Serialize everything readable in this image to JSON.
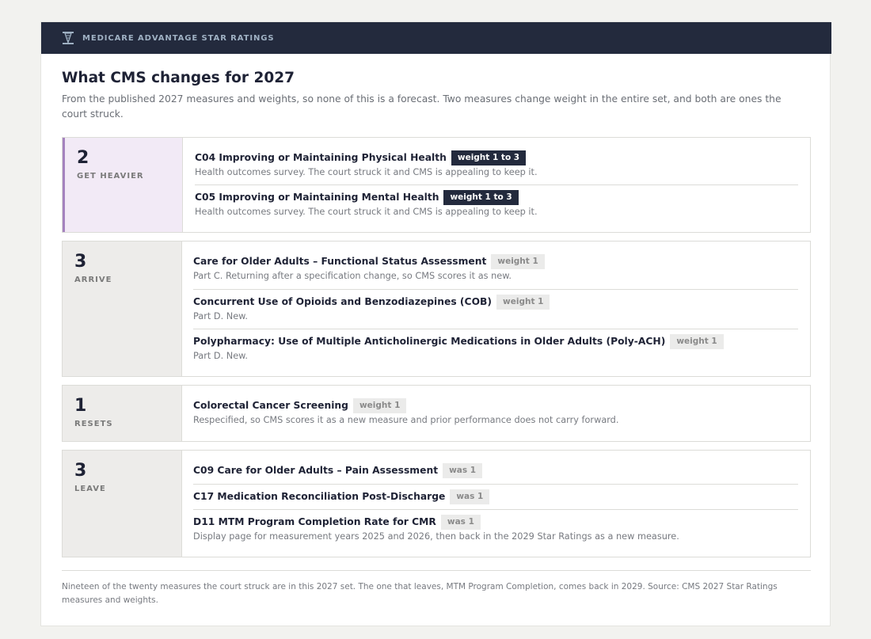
{
  "header": {
    "brand": "MEDICARE ADVANTAGE STAR RATINGS",
    "logo_icon": "scales-column-icon"
  },
  "title": "What CMS changes for 2027",
  "intro": "From the published 2027 measures and weights, so none of this is a forecast. Two measures change weight in the entire set, and both are ones the court struck.",
  "groups": [
    {
      "count": "2",
      "label": "GET HEAVIER",
      "items": [
        {
          "name": "C04 Improving or Maintaining Physical Health",
          "badge": "weight 1 to 3",
          "note": "Health outcomes survey. The court struck it and CMS is appealing to keep it."
        },
        {
          "name": "C05 Improving or Maintaining Mental Health",
          "badge": "weight 1 to 3",
          "note": "Health outcomes survey. The court struck it and CMS is appealing to keep it."
        }
      ]
    },
    {
      "count": "3",
      "label": "ARRIVE",
      "items": [
        {
          "name": "Care for Older Adults – Functional Status Assessment",
          "badge": "weight 1",
          "note": "Part C. Returning after a specification change, so CMS scores it as new."
        },
        {
          "name": "Concurrent Use of Opioids and Benzodiazepines (COB)",
          "badge": "weight 1",
          "note": "Part D. New."
        },
        {
          "name": "Polypharmacy: Use of Multiple Anticholinergic Medications in Older Adults (Poly-ACH)",
          "badge": "weight 1",
          "note": "Part D. New."
        }
      ]
    },
    {
      "count": "1",
      "label": "RESETS",
      "items": [
        {
          "name": "Colorectal Cancer Screening",
          "badge": "weight 1",
          "note": "Respecified, so CMS scores it as a new measure and prior performance does not carry forward."
        }
      ]
    },
    {
      "count": "3",
      "label": "LEAVE",
      "items": [
        {
          "name": "C09 Care for Older Adults – Pain Assessment",
          "badge": "was 1"
        },
        {
          "name": "C17 Medication Reconciliation Post-Discharge",
          "badge": "was 1"
        },
        {
          "name": "D11 MTM Program Completion Rate for CMR",
          "badge": "was 1",
          "note": "Display page for measurement years 2025 and 2026, then back in the 2029 Star Ratings as a new measure."
        }
      ]
    }
  ],
  "footnote": "Nineteen of the twenty measures the court struck are in this 2027 set. The one that leaves, MTM Program Completion, comes back in 2029. Source: CMS 2027 Star Ratings measures and weights.",
  "colors": {
    "navy": "#232a3d",
    "accent_purple": "#a583be",
    "heavy_bg": "#f2eaf6",
    "side_bg": "#edecea"
  }
}
